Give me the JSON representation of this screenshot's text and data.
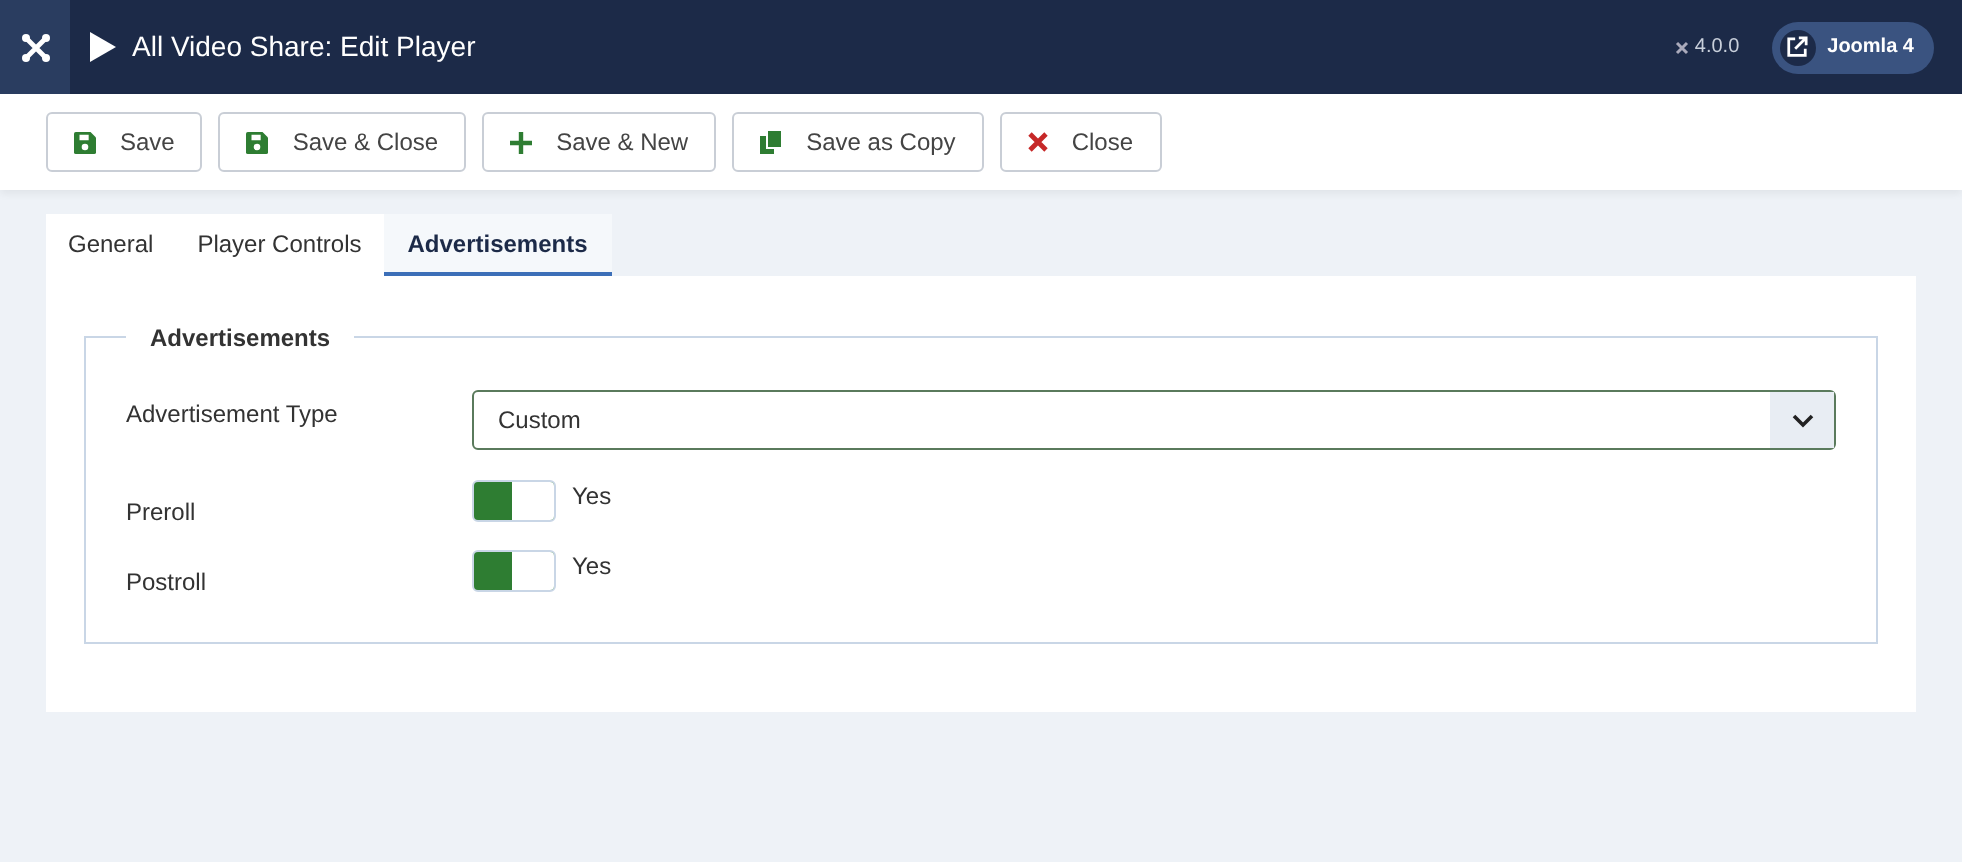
{
  "header": {
    "title": "All Video Share: Edit Player",
    "version": "4.0.0",
    "site_button": "Joomla 4"
  },
  "toolbar": [
    {
      "kind": "save",
      "label": "Save"
    },
    {
      "kind": "save",
      "label": "Save & Close"
    },
    {
      "kind": "new",
      "label": "Save & New"
    },
    {
      "kind": "copy",
      "label": "Save as Copy"
    },
    {
      "kind": "close",
      "label": "Close"
    }
  ],
  "tabs": [
    {
      "label": "General",
      "selected": false
    },
    {
      "label": "Player Controls",
      "selected": false
    },
    {
      "label": "Advertisements",
      "selected": true
    }
  ],
  "fieldset": {
    "legend": "Advertisements",
    "fields": [
      {
        "kind": "select",
        "label": "Advertisement Type",
        "value": "Custom"
      },
      {
        "kind": "toggle",
        "label": "Preroll",
        "on": true,
        "state_label": "Yes"
      },
      {
        "kind": "toggle",
        "label": "Postroll",
        "on": true,
        "state_label": "Yes"
      }
    ]
  }
}
